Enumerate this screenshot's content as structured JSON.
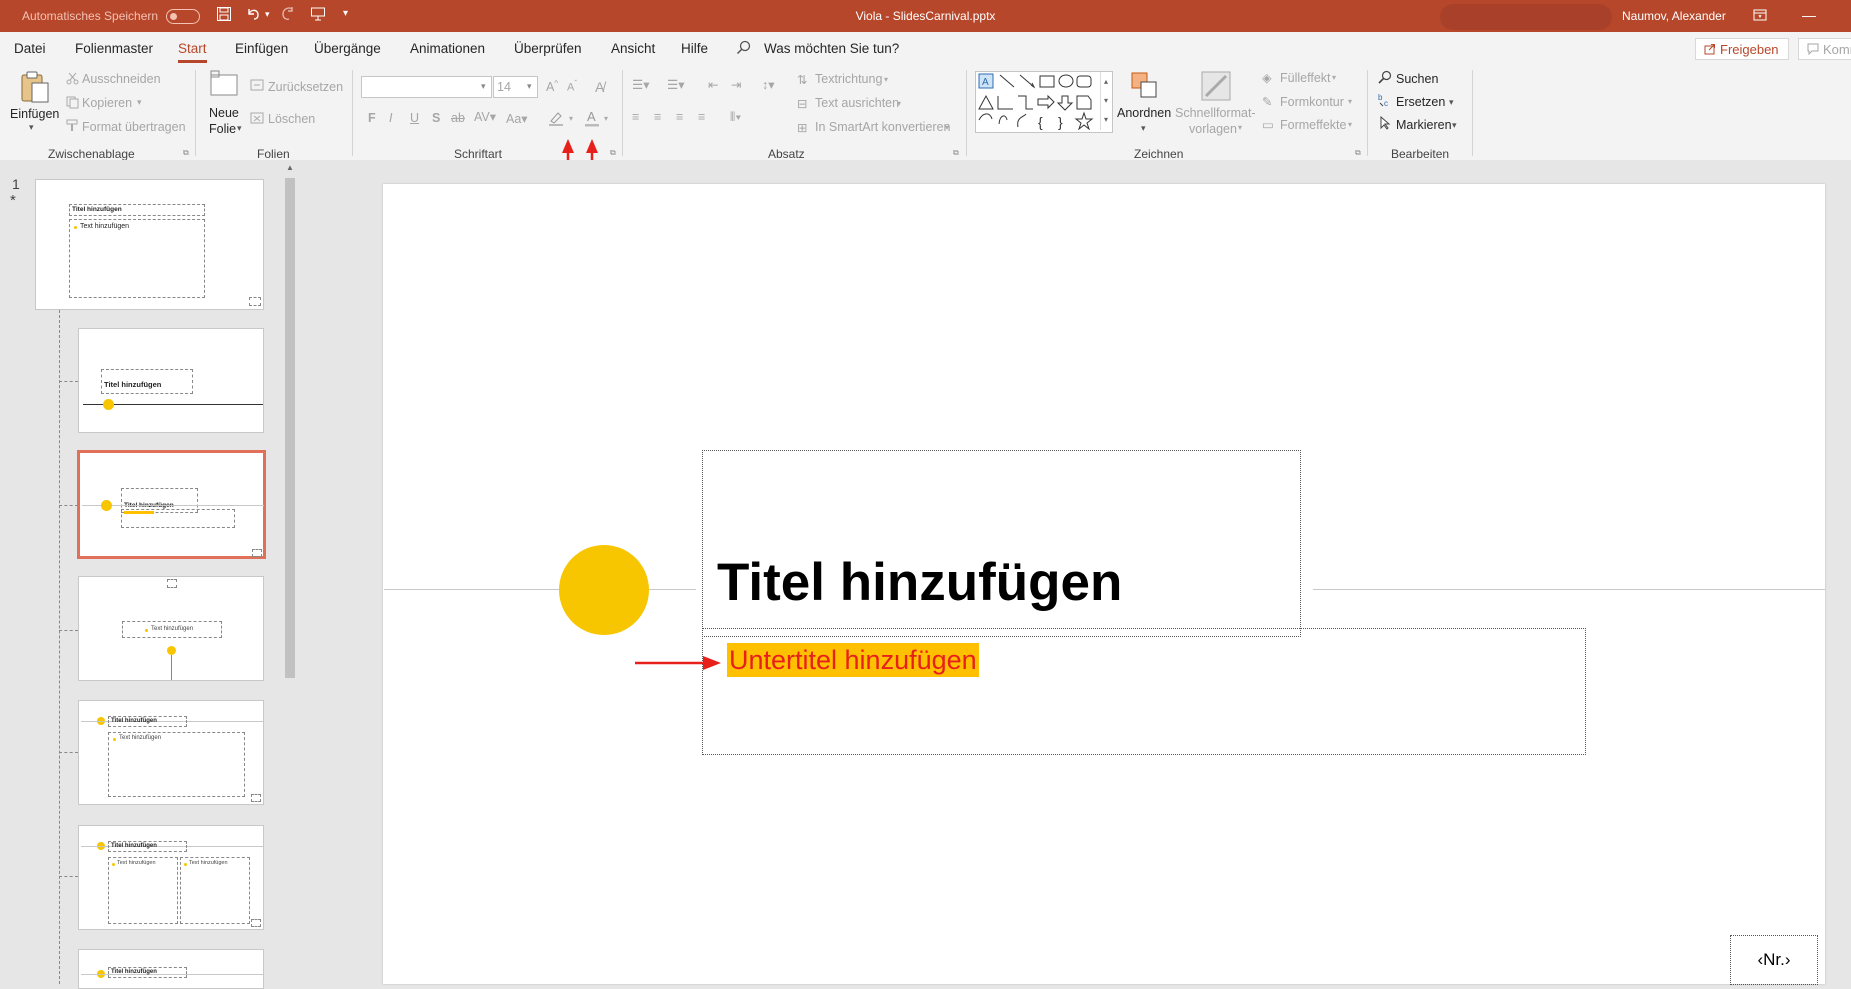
{
  "titlebar": {
    "autosave_label": "Automatisches Speichern",
    "window_title": "Viola - SlidesCarnival.pptx",
    "user_name": "Naumov, Alexander",
    "bg_color": "#b7472a"
  },
  "menu": {
    "items": [
      "Datei",
      "Folienmaster",
      "Start",
      "Einfügen",
      "Übergänge",
      "Animationen",
      "Überprüfen",
      "Ansicht",
      "Hilfe"
    ],
    "active": "Start",
    "tell_me": "Was möchten Sie tun?",
    "share": "Freigeben",
    "comments": "Komm"
  },
  "ribbon": {
    "clipboard": {
      "paste": "Einfügen",
      "cut": "Ausschneiden",
      "copy": "Kopieren",
      "format_painter": "Format übertragen",
      "group": "Zwischenablage"
    },
    "slides": {
      "new_slide_1": "Neue",
      "new_slide_2": "Folie",
      "reset": "Zurücksetzen",
      "delete": "Löschen",
      "group": "Folien"
    },
    "font": {
      "font_size": "14",
      "group": "Schriftart"
    },
    "paragraph": {
      "text_direction": "Textrichtung",
      "align_text": "Text ausrichten",
      "smartart": "In SmartArt konvertieren",
      "group": "Absatz"
    },
    "drawing": {
      "arrange": "Anordnen",
      "quick_styles_1": "Schnellformat-",
      "quick_styles_2": "vorlagen",
      "fill": "Fülleffekt",
      "outline": "Formkontur",
      "effects": "Formeffekte",
      "group": "Zeichnen"
    },
    "editing": {
      "find": "Suchen",
      "replace": "Ersetzen",
      "select": "Markieren",
      "group": "Bearbeiten"
    }
  },
  "thumbnails": {
    "master_number": "1",
    "master_star": "*",
    "master_title": "Titel hinzufügen",
    "master_text": "Text hinzufügen",
    "layout2_title": "Titel hinzufügen",
    "layout3_title": "Titel hinzufügen",
    "layout4_text": "Text hinzufügen",
    "layout5_title": "Titel hinzufügen",
    "layout5_text": "Text hinzufügen",
    "layout6_title": "Titel hinzufügen",
    "layout6_text_a": "Text hinzufügen",
    "layout6_text_b": "Text hinzufügen",
    "layout7_title": "Titel hinzufügen"
  },
  "slide": {
    "title": "Titel hinzufügen",
    "subtitle": "Untertitel hinzufügen",
    "slide_number": "‹Nr.›",
    "accent_color": "#ffc000",
    "subtitle_color": "#e8201b",
    "annotation_arrow_color": "#e8201b"
  }
}
